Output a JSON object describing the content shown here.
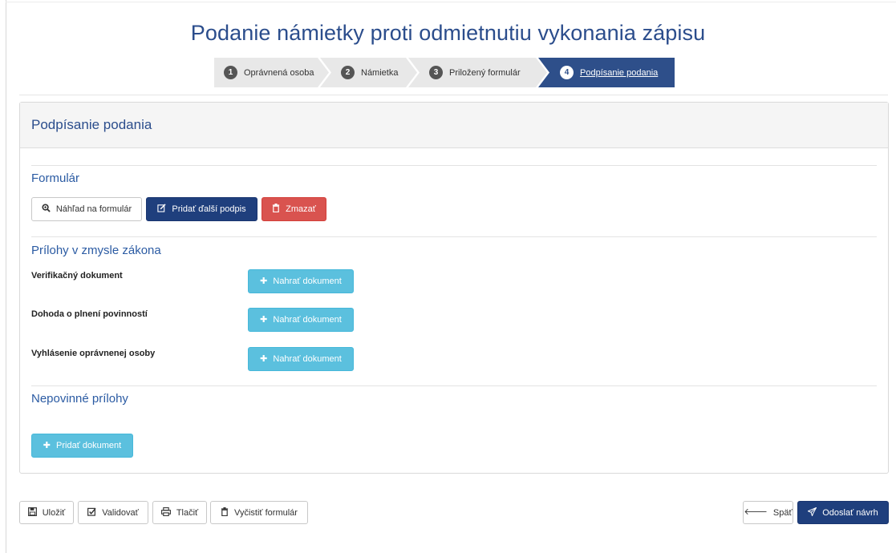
{
  "page": {
    "title": "Podanie námietky proti odmietnutiu vykonania zápisu"
  },
  "wizard": {
    "steps": [
      {
        "num": "1",
        "label": "Oprávnená osoba"
      },
      {
        "num": "2",
        "label": "Námietka"
      },
      {
        "num": "3",
        "label": "Priložený formulár"
      },
      {
        "num": "4",
        "label": "Podpísanie podania"
      }
    ],
    "active_step": 4
  },
  "panel": {
    "heading": "Podpísanie podania",
    "form_section": {
      "title": "Formulár",
      "preview_label": "Náhľad na formulár",
      "add_signature_label": "Pridať ďalší podpis",
      "delete_label": "Zmazať"
    },
    "attachments_section": {
      "title": "Prílohy v zmysle zákona",
      "items": [
        {
          "label": "Verifikačný dokument",
          "button": "Nahrať dokument"
        },
        {
          "label": "Dohoda o plnení povinností",
          "button": "Nahrať dokument"
        },
        {
          "label": "Vyhlásenie oprávnenej osoby",
          "button": "Nahrať dokument"
        }
      ]
    },
    "optional_section": {
      "title": "Nepovinné prílohy",
      "add_label": "Pridať dokument"
    }
  },
  "footer": {
    "save_label": "Uložiť",
    "validate_label": "Validovať",
    "print_label": "Tlačiť",
    "clear_label": "Vyčistiť formulár",
    "back_label": "Späť",
    "submit_label": "Odoslať návrh"
  },
  "colors": {
    "primary": "#1f3f7d",
    "title_blue": "#2b4d8c",
    "danger": "#d9534f",
    "info": "#5bc0de"
  },
  "icons": {
    "step_num": "numbered-circle",
    "preview": "magnifier-icon",
    "add_signature": "edit-icon",
    "delete": "trash-icon",
    "upload": "plus-icon",
    "save": "floppy-icon",
    "validate": "checkbox-icon",
    "print": "printer-icon",
    "clear": "trash-icon",
    "back": "arrow-left-icon",
    "submit": "paper-plane-icon"
  }
}
